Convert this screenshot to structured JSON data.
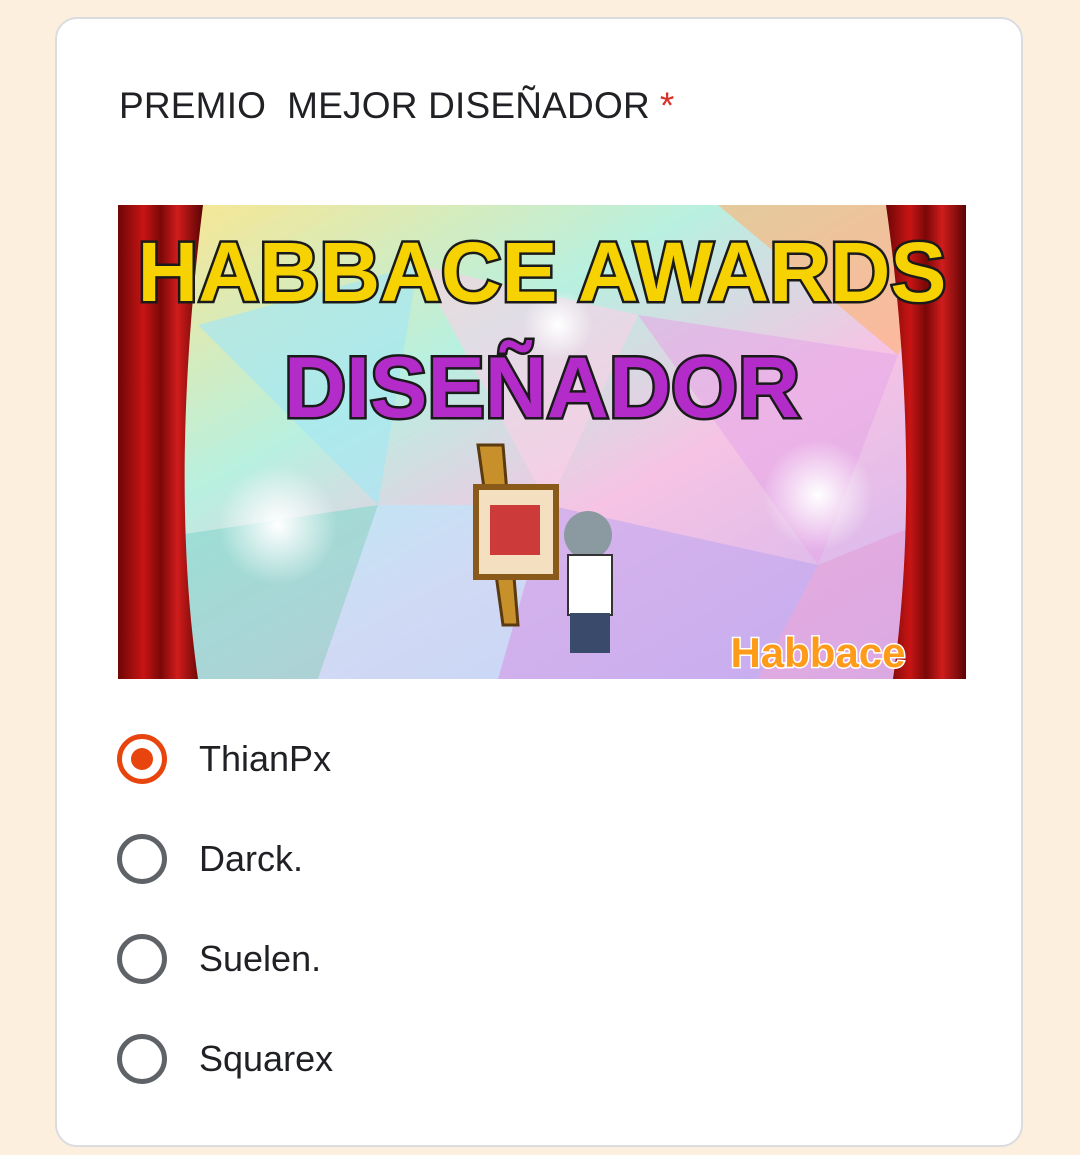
{
  "question": {
    "title": "PREMIO  MEJOR DISEÑADOR",
    "required_mark": "*"
  },
  "banner": {
    "title_line1": "HABBACE AWARDS",
    "title_line2": "DISEÑADOR",
    "logo_text": "Habbace"
  },
  "options": [
    {
      "label": "ThianPx",
      "selected": true
    },
    {
      "label": "Darck.",
      "selected": false
    },
    {
      "label": "Suelen.",
      "selected": false
    },
    {
      "label": "Squarex",
      "selected": false
    }
  ],
  "colors": {
    "accent": "#e8450e",
    "required": "#d93025",
    "page_background": "#fcefde"
  }
}
